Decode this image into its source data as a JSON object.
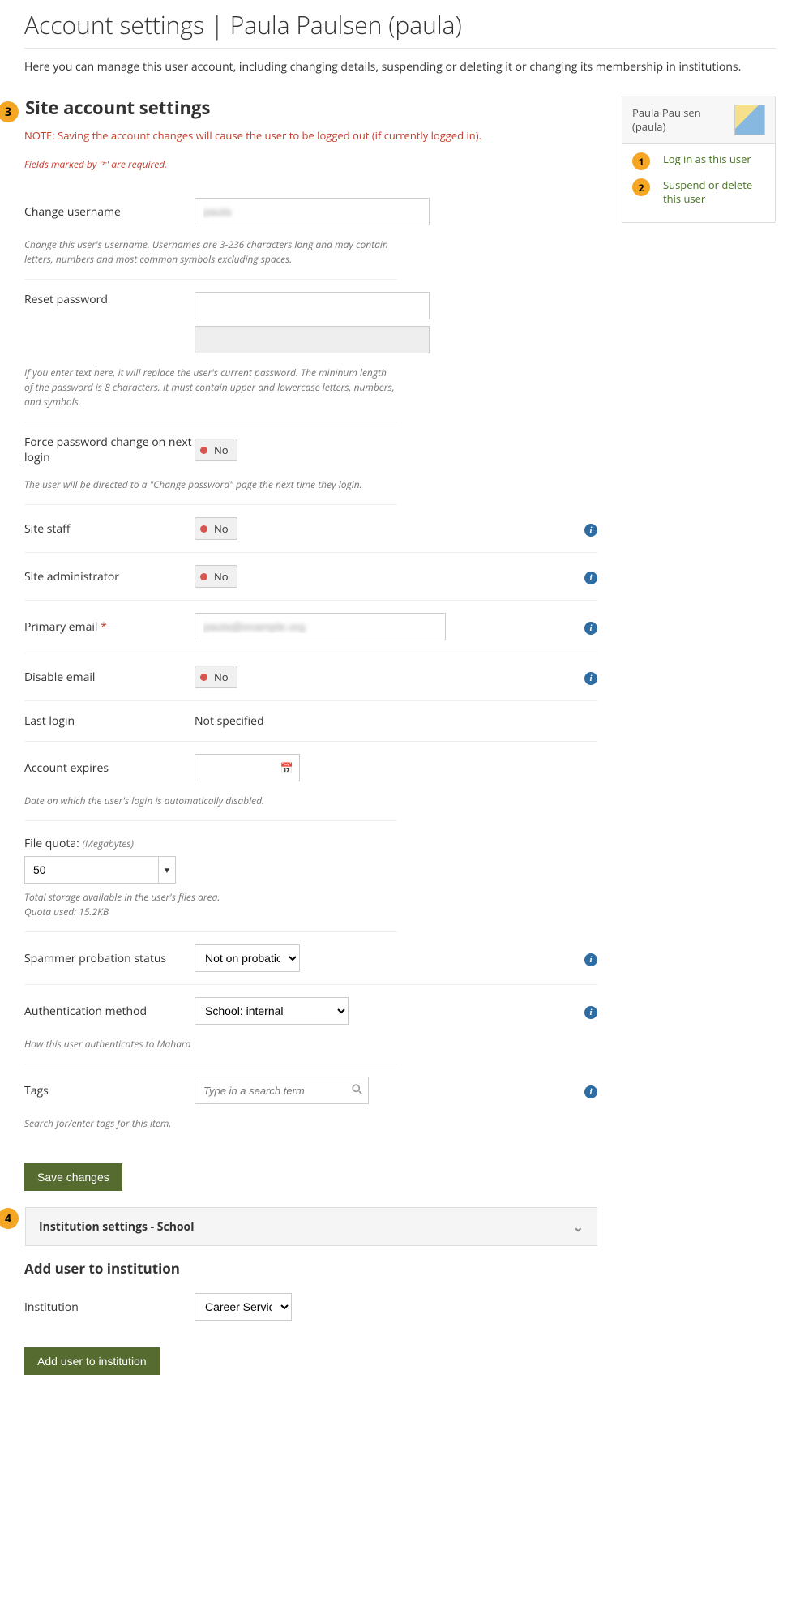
{
  "page": {
    "title": "Account settings | Paula Paulsen (paula)",
    "intro": "Here you can manage this user account, including changing details, suspending or deleting it or changing its membership in institutions."
  },
  "callouts": {
    "c1": "1",
    "c2": "2",
    "c3": "3",
    "c4": "4"
  },
  "sidebar": {
    "user_display": "Paula Paulsen (paula)",
    "login_as": "Log in as this user",
    "suspend": "Suspend or delete this user"
  },
  "section": {
    "heading": "Site account settings",
    "note": "NOTE: Saving the account changes will cause the user to be logged out (if currently logged in).",
    "required_hint": "Fields marked by '*' are required."
  },
  "fields": {
    "username": {
      "label": "Change username",
      "value": "paula",
      "help": "Change this user's username. Usernames are 3-236 characters long and may contain letters, numbers and most common symbols excluding spaces."
    },
    "resetpw": {
      "label": "Reset password",
      "help": "If you enter text here, it will replace the user's current password. The mininum length of the password is 8 characters. It must contain upper and lowercase letters, numbers, and symbols."
    },
    "forcepw": {
      "label": "Force password change on next login",
      "value": "No",
      "help": "The user will be directed to a \"Change password\" page the next time they login."
    },
    "staff": {
      "label": "Site staff",
      "value": "No"
    },
    "admin": {
      "label": "Site administrator",
      "value": "No"
    },
    "email": {
      "label": "Primary email",
      "value": "paula@example.org"
    },
    "disable_email": {
      "label": "Disable email",
      "value": "No"
    },
    "last_login": {
      "label": "Last login",
      "value": "Not specified"
    },
    "expires": {
      "label": "Account expires",
      "help": "Date on which the user's login is automatically disabled."
    },
    "quota": {
      "label": "File quota:",
      "unit": "(Megabytes)",
      "value": "50",
      "help": "Total storage available in the user's files area.",
      "used": "Quota used: 15.2KB"
    },
    "spammer": {
      "label": "Spammer probation status",
      "value": "Not on probation"
    },
    "authmethod": {
      "label": "Authentication method",
      "value": "School: internal",
      "help": "How this user authenticates to Mahara"
    },
    "tags": {
      "label": "Tags",
      "placeholder": "Type in a search term",
      "help": "Search for/enter tags for this item."
    }
  },
  "buttons": {
    "save": "Save changes",
    "add_inst": "Add user to institution"
  },
  "institution": {
    "panel_title": "Institution settings - School",
    "add_heading": "Add user to institution",
    "field_label": "Institution",
    "value": "Career Service"
  }
}
